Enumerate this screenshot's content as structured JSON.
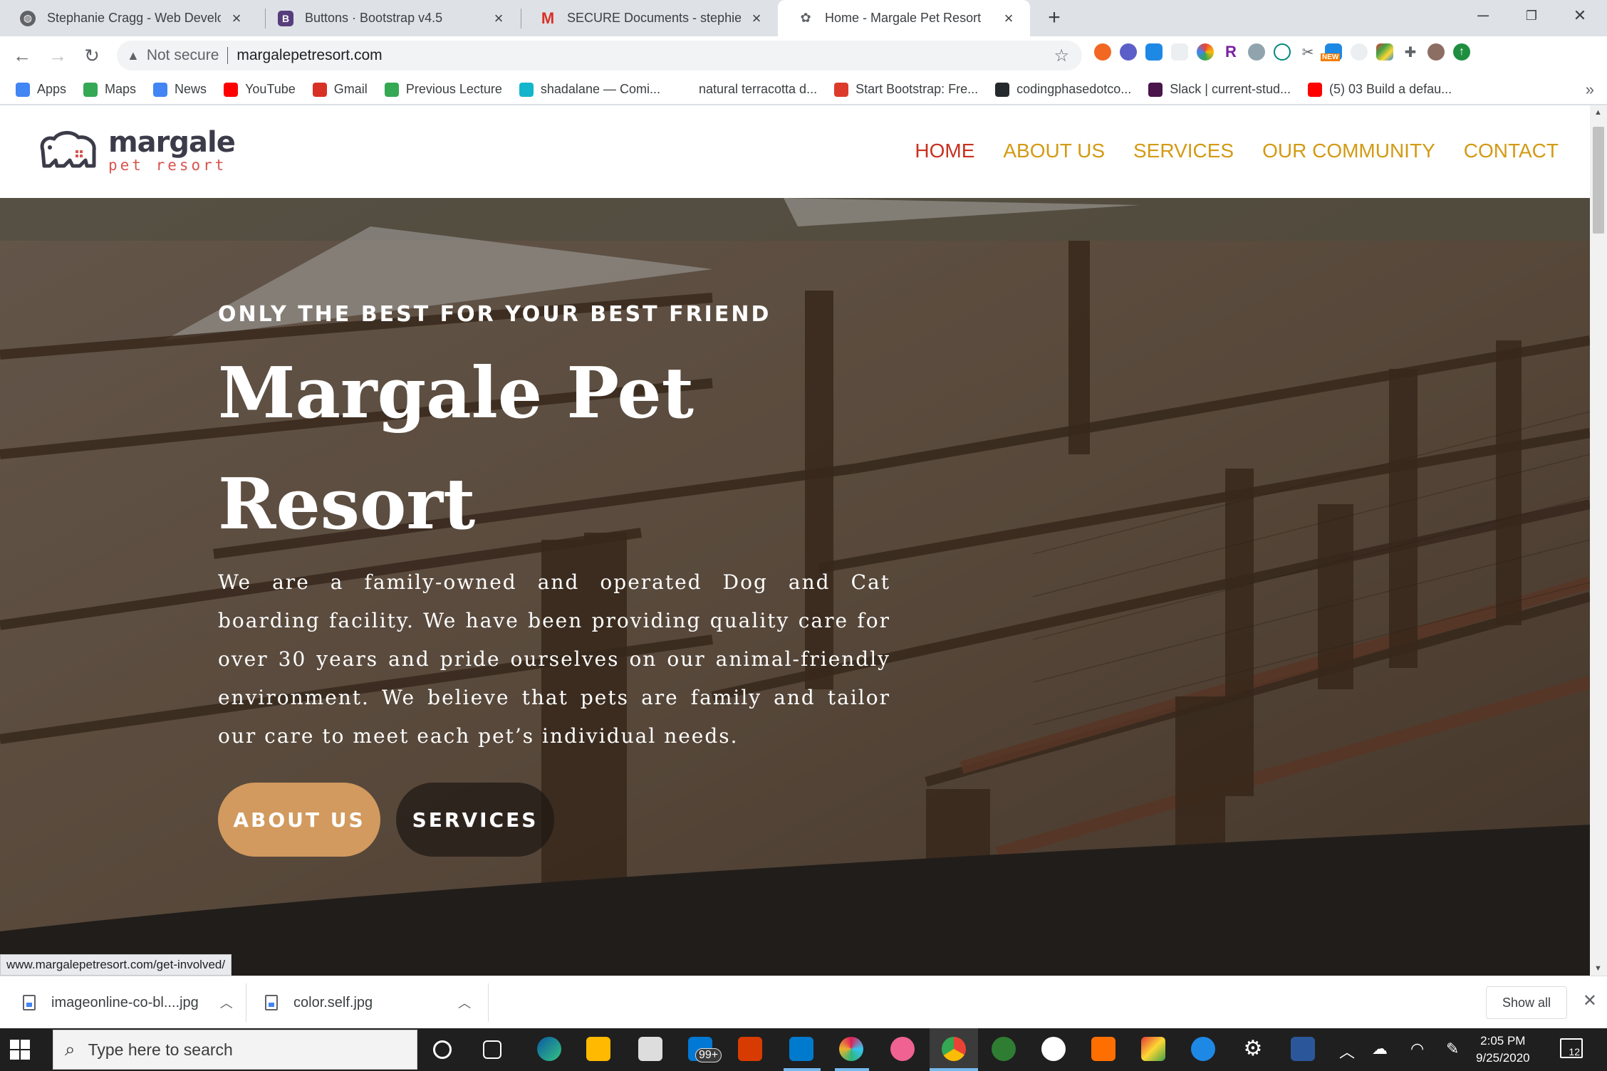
{
  "browser": {
    "tabs": [
      {
        "title": "Stephanie Cragg - Web Develope",
        "favicon": "globe-icon",
        "color": "#5f6368"
      },
      {
        "title": "Buttons · Bootstrap v4.5",
        "favicon": "bootstrap-icon",
        "color": "#563d7c"
      },
      {
        "title": "SECURE Documents - stephieplu",
        "favicon": "gmail-icon",
        "color": "#d93025"
      },
      {
        "title": "Home - Margale Pet Resort",
        "favicon": "paw-icon",
        "color": "#5f6368"
      }
    ],
    "address": {
      "security": "Not secure",
      "url": "margalepetresort.com"
    },
    "bookmarks": [
      {
        "label": "Apps",
        "icon": "apps-grid-icon",
        "color": "#4285f4"
      },
      {
        "label": "Maps",
        "icon": "maps-pin-icon",
        "color": "#34a853"
      },
      {
        "label": "News",
        "icon": "news-icon",
        "color": "#4285f4"
      },
      {
        "label": "YouTube",
        "icon": "youtube-icon",
        "color": "#ff0000"
      },
      {
        "label": "Gmail",
        "icon": "gmail-icon",
        "color": "#d93025"
      },
      {
        "label": "Previous Lecture",
        "icon": "lecture-icon",
        "color": "#34a853"
      },
      {
        "label": "shadalane — Comi...",
        "icon": "circle-icon",
        "color": "#12b5cb"
      },
      {
        "label": "natural terracotta d...",
        "icon": "google-icon",
        "color": "#ffffff"
      },
      {
        "label": "Start Bootstrap: Fre...",
        "icon": "startbootstrap-icon",
        "color": "#dd3b2a"
      },
      {
        "label": "codingphasedotco...",
        "icon": "github-icon",
        "color": "#24292e"
      },
      {
        "label": "Slack | current-stud...",
        "icon": "slack-icon",
        "color": "#4a154b"
      },
      {
        "label": "(5) 03 Build a defau...",
        "icon": "youtube-icon",
        "color": "#ff0000"
      }
    ],
    "bookmarks_more": "»",
    "status_url": "www.margalepetresort.com/get-involved/"
  },
  "site": {
    "logo": {
      "word": "margale",
      "sub": "pet resort"
    },
    "nav": [
      "HOME",
      "ABOUT US",
      "SERVICES",
      "OUR COMMUNITY",
      "CONTACT"
    ],
    "hero": {
      "eyebrow": "ONLY THE BEST FOR YOUR BEST FRIEND",
      "headline": "Margale Pet Resort",
      "body": "We are a family-owned and operated Dog and Cat boarding facility. We have been providing quality care for over 30 years and pride ourselves on our animal-friendly environment. We believe that pets are family and tailor our care to meet each pet’s individual needs.",
      "primary_button": "ABOUT US",
      "secondary_button": "SERVICES"
    },
    "colors": {
      "nav_accent": "#d39a14",
      "nav_active": "#c8311f",
      "primary_button": "#d29a5e"
    }
  },
  "downloads": {
    "items": [
      "imageonline-co-bl....jpg",
      "color.self.jpg"
    ],
    "show_all": "Show all"
  },
  "taskbar": {
    "search_placeholder": "Type here to search",
    "mail_badge": "99+",
    "time": "2:05 PM",
    "date": "9/25/2020",
    "notifications": "12"
  }
}
